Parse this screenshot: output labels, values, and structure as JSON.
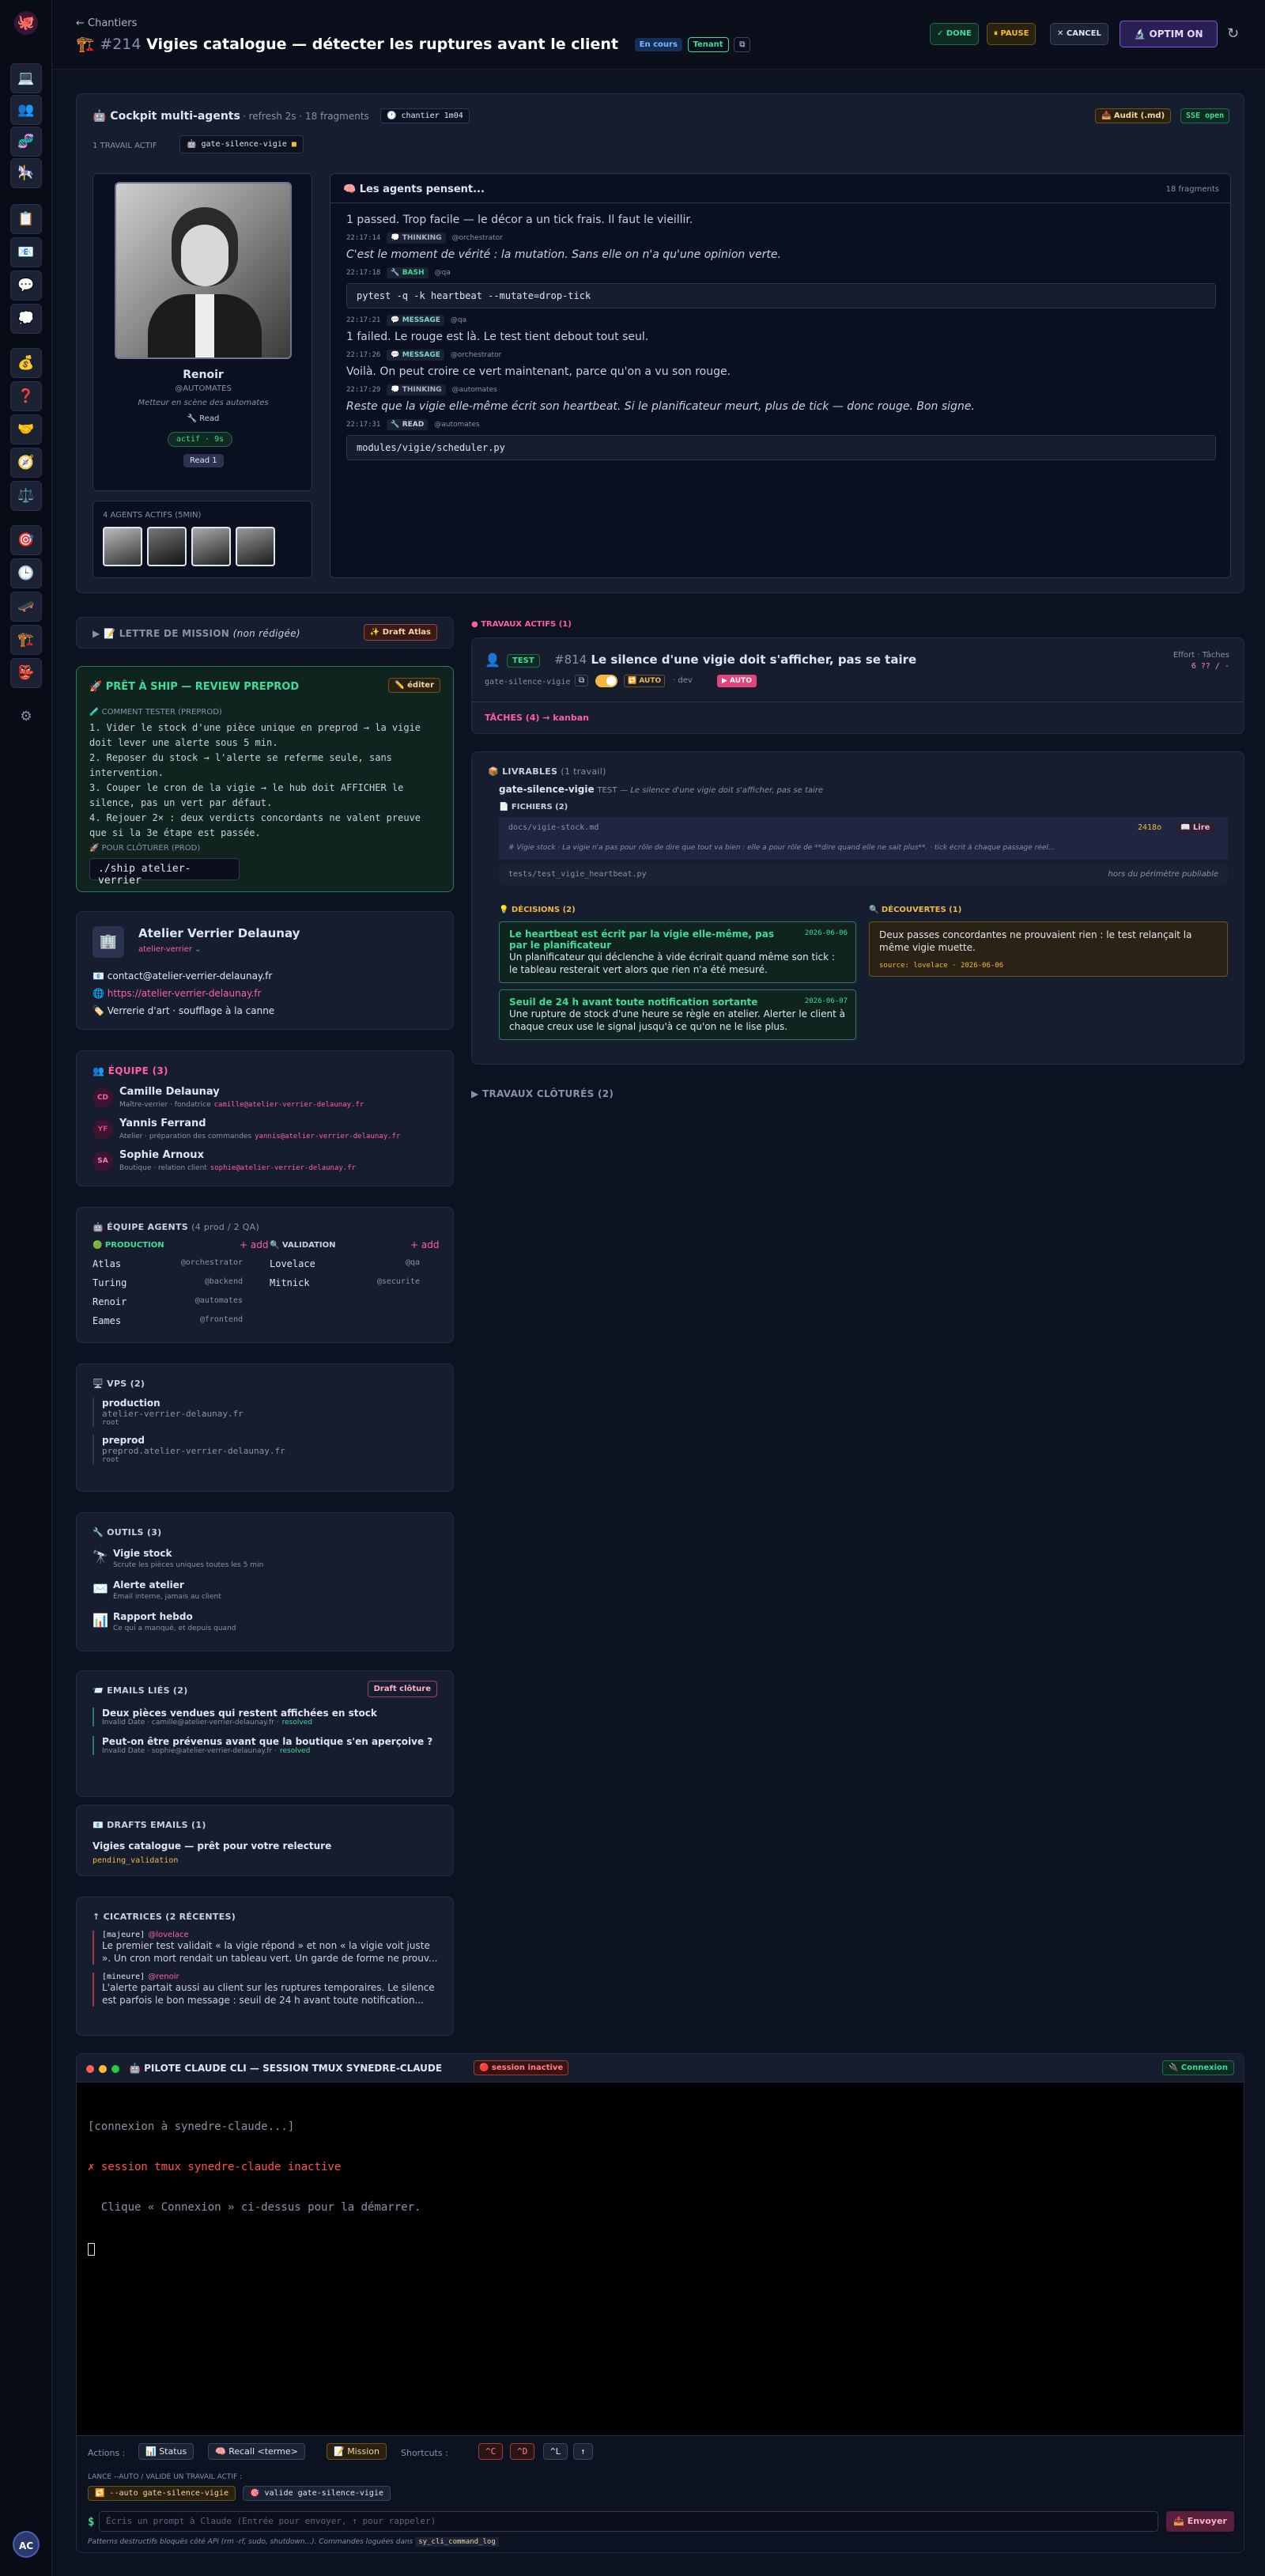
{
  "rail": {
    "icons": [
      "octopus-logo",
      "laptop-icon",
      "people-icon",
      "dna-icon",
      "circus-icon",
      "clipboard-icon",
      "envelope-icon",
      "speech-icon",
      "thought-icon",
      "moneybag-icon",
      "question-icon",
      "handshake-icon",
      "compass-icon",
      "scales-icon",
      "target-icon",
      "clock-icon",
      "skates-icon",
      "construction-icon",
      "ogre-icon",
      "gear-icon"
    ],
    "user_initials": "AC"
  },
  "header": {
    "back": "← Chantiers",
    "number": "#214",
    "title": "Vigies catalogue — détecter les ruptures avant le client",
    "status": "En cours",
    "tenant": "Tenant",
    "done": "✓ DONE",
    "pause": "⏸ PAUSE",
    "cancel": "✕ CANCEL",
    "optim": "🔬 OPTIM ON"
  },
  "cockpit": {
    "title": "🤖 Cockpit multi-agents",
    "refresh": "· refresh 2s · 18 fragments",
    "timer": "🕐 chantier 1m04",
    "audit": "📥 Audit (.md)",
    "sse": "SSE open",
    "active_work_label": "1 TRAVAIL ACTIF",
    "active_work": "gate-silence-vigie",
    "agent": {
      "name": "Renoir",
      "handle": "@AUTOMATES",
      "role": "Metteur en scène des automates",
      "tool": "🔧 Read",
      "status": "actif · 9s",
      "read": "Read 1"
    },
    "agents_label": "4 AGENTS ACTIFS (5MIN)",
    "feed_title": "🧠 Les agents pensent...",
    "feed_count": "18 fragments",
    "feed": [
      {
        "kind": "text",
        "text": "1 passed. Trop facile — le décor a un tick frais. Il faut le vieillir."
      },
      {
        "kind": "meta",
        "time": "22:17:14",
        "badge": "💭 THINKING",
        "who": "@orchestrator"
      },
      {
        "kind": "italic",
        "text": "C'est le moment de vérité : la mutation. Sans elle on n'a qu'une opinion verte."
      },
      {
        "kind": "meta",
        "time": "22:17:18",
        "badge": "🔧 BASH",
        "who": "@qa"
      },
      {
        "kind": "code",
        "text": "pytest -q -k heartbeat --mutate=drop-tick"
      },
      {
        "kind": "meta",
        "time": "22:17:21",
        "badge": "💬 MESSAGE",
        "who": "@qa"
      },
      {
        "kind": "text",
        "text": "1 failed. Le rouge est là. Le test tient debout tout seul."
      },
      {
        "kind": "meta",
        "time": "22:17:26",
        "badge": "💬 MESSAGE",
        "who": "@orchestrator"
      },
      {
        "kind": "text",
        "text": "Voilà. On peut croire ce vert maintenant, parce qu'on a vu son rouge."
      },
      {
        "kind": "meta",
        "time": "22:17:29",
        "badge": "💭 THINKING",
        "who": "@automates"
      },
      {
        "kind": "italic",
        "text": "Reste que la vigie elle-même écrit son heartbeat. Si le planificateur meurt, plus de tick — donc rouge. Bon signe."
      },
      {
        "kind": "meta",
        "time": "22:17:31",
        "badge": "🔧 READ",
        "who": "@automates"
      },
      {
        "kind": "code",
        "text": "modules/vigie/scheduler.py"
      }
    ]
  },
  "mission": {
    "title": "LETTRE DE MISSION",
    "sub": "(non rédigée)",
    "draft": "✨ Draft Atlas"
  },
  "ship": {
    "title": "🚀 PRÊT À SHIP — REVIEW PREPROD",
    "edit": "✏️ éditer",
    "test_label": "🧪 COMMENT TESTER (PREPROD)",
    "steps": [
      "1. Vider le stock d'une pièce unique en preprod → la vigie doit lever une alerte sous 5 min.",
      "2. Reposer du stock → l'alerte se referme seule, sans intervention.",
      "3. Couper le cron de la vigie → le hub doit AFFICHER le silence, pas un vert par défaut.",
      "4. Rejouer 2× : deux verdicts concordants ne valent preuve que si la 3e étape est passée."
    ],
    "close_label": "🚀 POUR CLÔTURER (PROD)",
    "command": "./ship atelier-verrier"
  },
  "client": {
    "name": "Atelier Verrier Delaunay",
    "slug": "atelier-verrier",
    "email": "📧 contact@atelier-verrier-delaunay.fr",
    "site": "https://atelier-verrier-delaunay.fr",
    "site_icon": "🌐",
    "sector": "🏷️ Verrerie d'art · soufflage à la canne"
  },
  "team": {
    "title": "👥 ÉQUIPE (3)",
    "members": [
      {
        "initials": "CD",
        "name": "Camille Delaunay",
        "role": "Maître-verrier · fondatrice",
        "email": "camille@atelier-verrier-delaunay.fr"
      },
      {
        "initials": "YF",
        "name": "Yannis Ferrand",
        "role": "Atelier · préparation des commandes",
        "email": "yannis@atelier-verrier-delaunay.fr"
      },
      {
        "initials": "SA",
        "name": "Sophie Arnoux",
        "role": "Boutique · relation client",
        "email": "sophie@atelier-verrier-delaunay.fr"
      }
    ]
  },
  "agents_team": {
    "title": "🤖 ÉQUIPE AGENTS",
    "sub": "(4 prod / 2 QA)",
    "prod_label": "🟢 PRODUCTION",
    "val_label": "🔍 VALIDATION",
    "add": "+ add",
    "prod": [
      {
        "name": "Atlas",
        "handle": "@orchestrator"
      },
      {
        "name": "Turing",
        "handle": "@backend"
      },
      {
        "name": "Renoir",
        "handle": "@automates"
      },
      {
        "name": "Eames",
        "handle": "@frontend"
      }
    ],
    "val": [
      {
        "name": "Lovelace",
        "handle": "@qa"
      },
      {
        "name": "Mitnick",
        "handle": "@securite"
      }
    ]
  },
  "vps": {
    "title": "🖥️ VPS (2)",
    "items": [
      {
        "name": "production",
        "host": "atelier-verrier-delaunay.fr",
        "user": "root"
      },
      {
        "name": "preprod",
        "host": "preprod.atelier-verrier-delaunay.fr",
        "user": "root"
      }
    ]
  },
  "tools": {
    "title": "🔧 OUTILS (3)",
    "items": [
      {
        "icon": "🔭",
        "name": "Vigie stock",
        "desc": "Scrute les pièces uniques toutes les 5 min"
      },
      {
        "icon": "✉️",
        "name": "Alerte atelier",
        "desc": "Email interne, jamais au client"
      },
      {
        "icon": "📊",
        "name": "Rapport hebdo",
        "desc": "Ce qui a manqué, et depuis quand"
      }
    ]
  },
  "emails": {
    "title": "📨 EMAILS LIÉS (2)",
    "draft": "Draft clôture",
    "items": [
      {
        "subject": "Deux pièces vendues qui restent affichées en stock",
        "from": "Invalid Date · camille@atelier-verrier-delaunay.fr ·",
        "status": "resolved"
      },
      {
        "subject": "Peut-on être prévenus avant que la boutique s'en aperçoive ?",
        "from": "Invalid Date · sophie@atelier-verrier-delaunay.fr ·",
        "status": "resolved"
      }
    ]
  },
  "drafts": {
    "title": "📧 DRAFTS EMAILS (1)",
    "subject": "Vigies catalogue — prêt pour votre relecture",
    "status": "pending_validation"
  },
  "scars": {
    "title": "↑ CICATRICES (2 RÉCENTES)",
    "items": [
      {
        "sev": "[majeure]",
        "who": "@lovelace",
        "text": "Le premier test validait « la vigie répond » et non « la vigie voit juste ». Un cron mort rendait un tableau vert. Un garde de forme ne prouv..."
      },
      {
        "sev": "[mineure]",
        "who": "@renoir",
        "text": "L'alerte partait aussi au client sur les ruptures temporaires. Le silence est parfois le bon message : seuil de 24 h avant toute notification..."
      }
    ]
  },
  "works": {
    "title": "TRAVAUX ACTIFS (1)",
    "icon": "👤",
    "badge": "TEST",
    "num": "#814",
    "name": "Le silence d'une vigie doit s'afficher, pas se taire",
    "slug": "gate-silence-vigie",
    "auto": "🔁 AUTO",
    "dev": "· dev",
    "auto2": "▶ AUTO",
    "effort": "Effort · Tâches",
    "effort_val": "6 ?? / -",
    "tasks": "TÂCHES (4) → kanban"
  },
  "deliv": {
    "title": "📦 LIVRABLES",
    "sub": "(1 travail)",
    "slug": "gate-silence-vigie",
    "kind": "TEST",
    "desc": "— Le silence d'une vigie doit s'afficher, pas se taire",
    "files_label": "📄 FICHIERS (2)",
    "file1": "docs/vigie-stock.md",
    "file1_size": "2418o",
    "file1_read": "📖 Lire",
    "file1_note": "# Vigie stock · La vigie n'a pas pour rôle de dire que tout va bien : elle a pour rôle de **dire quand elle ne sait plus**. · tick écrit à chaque passage réel...",
    "file2": "tests/test_vigie_heartbeat.py",
    "file2_note": "hors du périmètre publiable",
    "dec_label": "💡 DÉCISIONS (2)",
    "disc_label": "🔍 DÉCOUVERTES (1)",
    "decisions": [
      {
        "title": "Le heartbeat est écrit par la vigie elle-même, pas par le planificateur",
        "date": "2026-06-06",
        "body": "Un planificateur qui déclenche à vide écrirait quand même son tick : le tableau resterait vert alors que rien n'a été mesuré."
      },
      {
        "title": "Seuil de 24 h avant toute notification sortante",
        "date": "2026-06-07",
        "body": "Une rupture de stock d'une heure se règle en atelier. Alerter le client à chaque creux use le signal jusqu'à ce qu'on ne le lise plus."
      }
    ],
    "discovery": {
      "text": "Deux passes concordantes ne prouvaient rien : le test relançait la même vigie muette.",
      "source": "source: lovelace · 2026-06-06"
    }
  },
  "closed": "▶ TRAVAUX CLÔTURÉS (2)",
  "term": {
    "title": "🤖 PILOTE CLAUDE CLI — SESSION TMUX SYNEDRE-CLAUDE",
    "status": "🔴 session inactive",
    "connect": "🔌 Connexion",
    "lines": [
      "[connexion à synedre-claude...]",
      "✗ session tmux synedre-claude inactive",
      "  Clique « Connexion » ci-dessus pour la démarrer."
    ],
    "actions_label": "Actions :",
    "a_status": "📊 Status",
    "a_recall": "🧠 Recall <terme>",
    "a_mission": "📝 Mission",
    "shortcuts": "Shortcuts :",
    "keys": [
      "^C",
      "^D",
      "^L",
      "↑"
    ],
    "launch_label": "LANCE --AUTO / VALIDE UN TRAVAIL ACTIF :",
    "l_auto": "🔁 --auto gate-silence-vigie",
    "l_valid": "🎯 valide gate-silence-vigie",
    "prompt": "Écris un prompt à Claude (Entrée pour envoyer, ↑ pour rappeler)",
    "send": "📤 Envoyer",
    "foot": "Patterns destructifs bloqués côté API (rm -rf, sudo, shutdown...). Commandes loguées dans",
    "foot_code": "sy_cli_command_log"
  }
}
